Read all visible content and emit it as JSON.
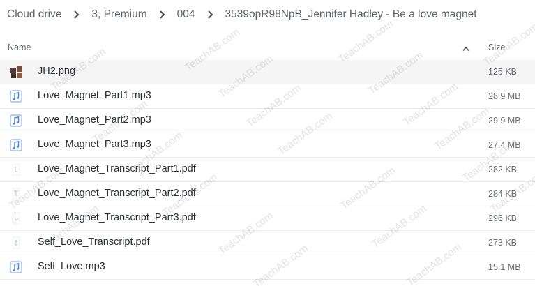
{
  "breadcrumb": [
    {
      "label": "Cloud drive"
    },
    {
      "label": "3, Premium"
    },
    {
      "label": "004"
    },
    {
      "label": "3539opR98NpB_Jennifer Hadley - Be a love magnet"
    }
  ],
  "columns": {
    "name": "Name",
    "size": "Size",
    "sort": "ascending"
  },
  "files": [
    {
      "name": "JH2.png",
      "size": "125 KB",
      "icon": "image-thumbnail-icon"
    },
    {
      "name": "Love_Magnet_Part1.mp3",
      "size": "28.9 MB",
      "icon": "audio-file-icon"
    },
    {
      "name": "Love_Magnet_Part2.mp3",
      "size": "29.9 MB",
      "icon": "audio-file-icon"
    },
    {
      "name": "Love_Magnet_Part3.mp3",
      "size": "27.4 MB",
      "icon": "audio-file-icon"
    },
    {
      "name": "Love_Magnet_Transcript_Part1.pdf",
      "size": "282 KB",
      "icon": "pdf-thumbnail-icon"
    },
    {
      "name": "Love_Magnet_Transcript_Part2.pdf",
      "size": "284 KB",
      "icon": "pdf-thumbnail-icon"
    },
    {
      "name": "Love_Magnet_Transcript_Part3.pdf",
      "size": "296 KB",
      "icon": "pdf-thumbnail-icon"
    },
    {
      "name": "Self_Love_Transcript.pdf",
      "size": "273 KB",
      "icon": "pdf-thumbnail-icon"
    },
    {
      "name": "Self_Love.mp3",
      "size": "15.1 MB",
      "icon": "audio-file-icon"
    }
  ],
  "watermark": "TeachAB.com",
  "colors": {
    "audio_icon": "#5b8dde",
    "hover_row": "#f5f5f5"
  }
}
